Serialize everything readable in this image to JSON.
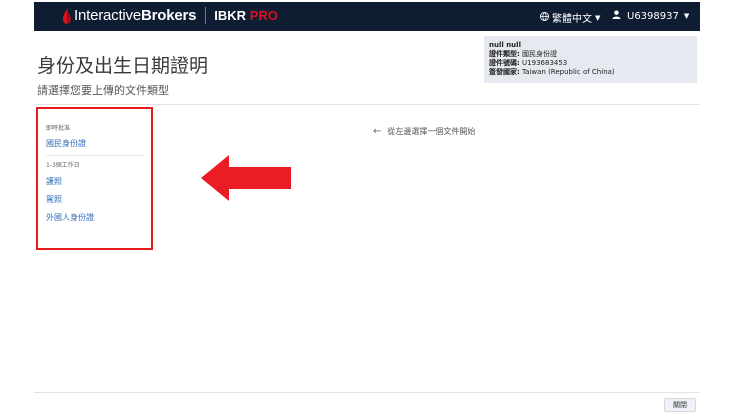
{
  "header": {
    "brand_name_light": "Interactive",
    "brand_name_bold": "Brokers",
    "brand_product_prefix": "IBKR ",
    "brand_product_accent": "PRO",
    "language_label": "繁體中文",
    "user_label": "U6398937",
    "brand_accent_color": "#d81222",
    "bar_color": "#0f1d33"
  },
  "page": {
    "title": "身份及出生日期證明",
    "subtitle": "請選擇您要上傳的文件類型"
  },
  "info_box": {
    "name": "null null",
    "doc_type_label": "證件類型:",
    "doc_type_value": "國民身份證",
    "doc_number_label": "證件號碼:",
    "doc_number_value": "U193683453",
    "issuing_country_label": "簽發國家:",
    "issuing_country_value": "Taiwan (Republic of China)"
  },
  "doc_list": {
    "instant_label": "即時批准",
    "instant_items": [
      "國民身份證"
    ],
    "days_label": "1-3個工作日",
    "days_items": [
      "護照",
      "駕照",
      "外國人身份證"
    ]
  },
  "hint": {
    "text": "從左邊選擇一個文件開始"
  },
  "footer": {
    "close_label": "關閉"
  }
}
